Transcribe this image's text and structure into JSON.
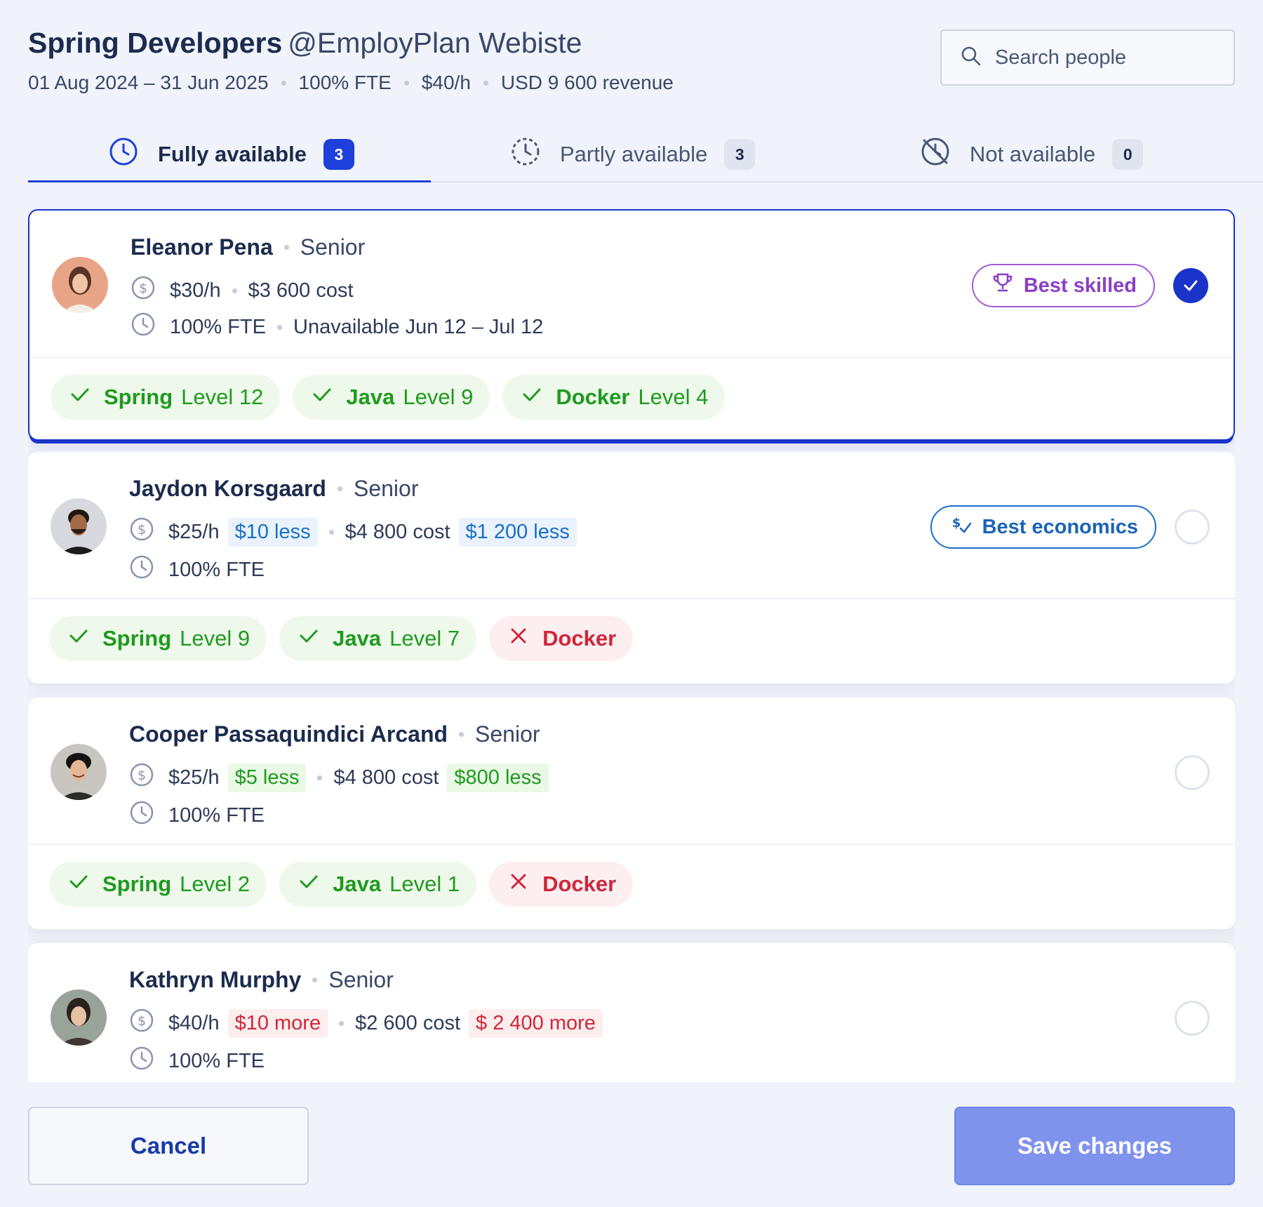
{
  "header": {
    "title": "Spring Developers",
    "project": "@EmployPlan Webiste",
    "period": "01 Aug 2024 – 31 Jun 2025",
    "fte": "100% FTE",
    "rate": "$40/h",
    "revenue": "USD 9 600 revenue"
  },
  "search": {
    "placeholder": "Search people",
    "icon": "search-icon"
  },
  "tabs": [
    {
      "label": "Fully available",
      "count": "3",
      "icon": "clock-icon",
      "active": true
    },
    {
      "label": "Partly available",
      "count": "3",
      "icon": "clock-dashed-icon",
      "active": false
    },
    {
      "label": "Not available",
      "count": "0",
      "icon": "clock-off-icon",
      "active": false
    }
  ],
  "people": [
    {
      "name": "Eleanor Pena",
      "level": "Senior",
      "rate": "$30/h",
      "cost": "$3 600 cost",
      "fte": "100% FTE",
      "availability_note": "Unavailable Jun 12 – Jul 12",
      "badge": "Best skilled",
      "selected": true,
      "skills": [
        {
          "name": "Spring",
          "level": "Level 12",
          "ok": true
        },
        {
          "name": "Java",
          "level": "Level 9",
          "ok": true
        },
        {
          "name": "Docker",
          "level": "Level 4",
          "ok": true
        }
      ]
    },
    {
      "name": "Jaydon Korsgaard",
      "level": "Senior",
      "rate": "$25/h",
      "rate_delta": "$10 less",
      "cost": "$4 800 cost",
      "cost_delta": "$1 200 less",
      "fte": "100% FTE",
      "badge": "Best economics",
      "selected": false,
      "skills": [
        {
          "name": "Spring",
          "level": "Level 9",
          "ok": true
        },
        {
          "name": "Java",
          "level": "Level 7",
          "ok": true
        },
        {
          "name": "Docker",
          "level": "",
          "ok": false
        }
      ]
    },
    {
      "name": "Cooper Passaquindici Arcand",
      "level": "Senior",
      "rate": "$25/h",
      "rate_delta": "$5 less",
      "cost": "$4 800 cost",
      "cost_delta": "$800 less",
      "fte": "100% FTE",
      "selected": false,
      "skills": [
        {
          "name": "Spring",
          "level": "Level 2",
          "ok": true
        },
        {
          "name": "Java",
          "level": "Level 1",
          "ok": true
        },
        {
          "name": "Docker",
          "level": "",
          "ok": false
        }
      ]
    },
    {
      "name": "Kathryn Murphy",
      "level": "Senior",
      "rate": "$40/h",
      "rate_delta": "$10 more",
      "cost": "$2 600 cost",
      "cost_delta": "$ 2 400 more",
      "fte": "100% FTE",
      "selected": false
    }
  ],
  "footer": {
    "cancel": "Cancel",
    "save": "Save changes"
  },
  "colors": {
    "accent": "#1e3fdc",
    "success": "#1f9a1f",
    "danger": "#d0263b",
    "info": "#1a6fc9",
    "purple": "#8a3fc6",
    "save_button": "#7f93ec"
  }
}
